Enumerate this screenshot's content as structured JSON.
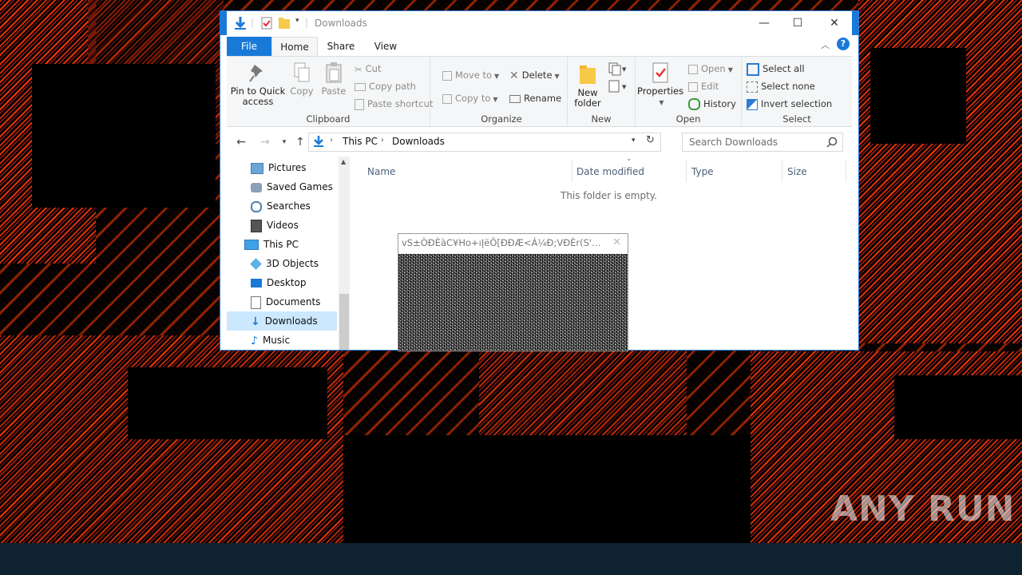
{
  "window": {
    "title": "Downloads",
    "controls": {
      "minimize": "—",
      "maximize": "☐",
      "close": "✕"
    }
  },
  "ribbon_tabs": [
    "File",
    "Home",
    "Share",
    "View"
  ],
  "ribbon": {
    "clipboard": {
      "label": "Clipboard",
      "pin_label_1": "Pin to Quick",
      "pin_label_2": "access",
      "copy": "Copy",
      "paste": "Paste",
      "cut": "Cut",
      "copy_path": "Copy path",
      "paste_shortcut": "Paste shortcut"
    },
    "organize": {
      "label": "Organize",
      "move_to": "Move to",
      "copy_to": "Copy to",
      "delete": "Delete",
      "rename": "Rename"
    },
    "new": {
      "label": "New",
      "new_folder_1": "New",
      "new_folder_2": "folder"
    },
    "open": {
      "label": "Open",
      "properties": "Properties",
      "open": "Open",
      "edit": "Edit",
      "history": "History"
    },
    "select": {
      "label": "Select",
      "select_all": "Select all",
      "select_none": "Select none",
      "invert_selection": "Invert selection"
    }
  },
  "address": {
    "crumbs": [
      "This PC",
      "Downloads"
    ],
    "search_placeholder": "Search Downloads"
  },
  "nav_pane": {
    "items": [
      {
        "label": "Pictures",
        "icon": "pictures-icon"
      },
      {
        "label": "Saved Games",
        "icon": "saved-games-icon"
      },
      {
        "label": "Searches",
        "icon": "searches-icon"
      },
      {
        "label": "Videos",
        "icon": "videos-icon"
      },
      {
        "label": "This PC",
        "icon": "this-pc-icon"
      },
      {
        "label": "3D Objects",
        "icon": "3d-objects-icon"
      },
      {
        "label": "Desktop",
        "icon": "desktop-icon"
      },
      {
        "label": "Documents",
        "icon": "documents-icon"
      },
      {
        "label": "Downloads",
        "icon": "downloads-icon"
      },
      {
        "label": "Music",
        "icon": "music-icon"
      }
    ],
    "selected": "Downloads"
  },
  "content": {
    "columns": [
      "Name",
      "Date modified",
      "Type",
      "Size"
    ],
    "empty_message": "This folder is empty."
  },
  "popup": {
    "title": "vS±ÒÐÈàC¥Ho+ıĮëÔ[ĐĐÆ<Á¼Ð;VĐÈr(S'äV..."
  },
  "watermark": "ANY RUN",
  "colors": {
    "accent": "#1979d7",
    "selection": "#cce8ff",
    "taskbar": "#0e2230",
    "glitch": "#ff3b0a"
  }
}
